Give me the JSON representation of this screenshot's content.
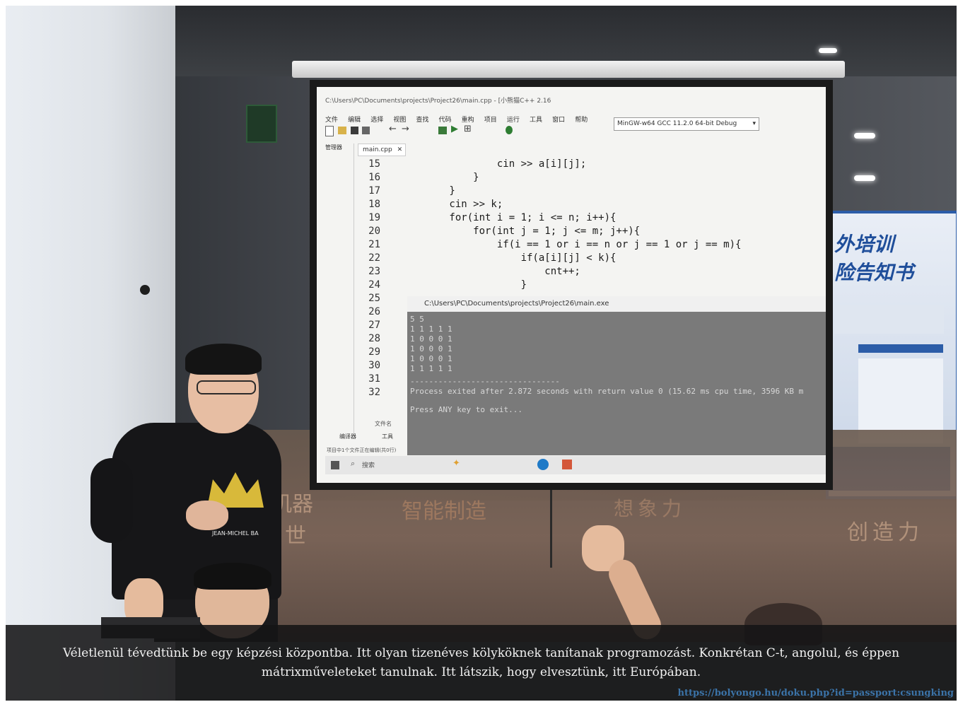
{
  "caption": {
    "line1": "Véletlenül tévedtünk be egy képzési központba. Itt olyan tizenéves kölyköknek tanítanak programozást. Konkrétan C-t, angolul, és éppen",
    "line2": "mátrixműveleteket tanulnak. Itt látszik, hogy elvesztünk, itt Európában."
  },
  "source_url": "https://bolyongo.hu/doku.php?id=passport:csungking",
  "screen": {
    "window_title": "C:\\Users\\PC\\Documents\\projects\\Project26\\main.cpp - [小熊猫C++ 2.16",
    "menu": [
      "文件",
      "编辑",
      "选择",
      "视图",
      "查找",
      "代码",
      "重构",
      "项目",
      "运行",
      "工具",
      "窗口",
      "帮助"
    ],
    "compiler_select": "MinGW-w64 GCC 11.2.0 64-bit Debug",
    "side_panel_tab": "管理器",
    "editor_tab": "main.cpp",
    "line_numbers": [
      "15",
      "16",
      "17",
      "18",
      "19",
      "20",
      "21",
      "22",
      "23",
      "24",
      "25",
      "26",
      "27",
      "28",
      "29",
      "30",
      "31",
      "32"
    ],
    "code_lines": [
      "                cin >> a[i][j];",
      "            }",
      "        }",
      "        cin >> k;",
      "        for(int i = 1; i <= n; i++){",
      "            for(int j = 1; j <= m; j++){",
      "                if(i == 1 or i == n or j == 1 or j == m){",
      "                    if(a[i][j] < k){",
      "                        cnt++;",
      "                    }"
    ],
    "console_title": "C:\\Users\\PC\\Documents\\projects\\Project26\\main.exe",
    "console_lines": [
      "5 5",
      "1 1 1 1 1",
      "1 0 0 0 1",
      "1 0 0 0 1",
      "1 0 0 0 1",
      "1 1 1 1 1"
    ],
    "console_separator": "--------------------------------",
    "console_exit": "Process exited after 2.872 seconds with return value 0 (15.62 ms cpu time, 3596 KB m",
    "console_press": "Press ANY key to exit...",
    "bottom_panel_label": "文件名",
    "bottom_tabs": [
      "编译器",
      "工具"
    ],
    "status_text": "项目中1个文件正在编辑(共0行)",
    "taskbar_search": "搜索"
  },
  "wall_sign": {
    "line1": "外培训",
    "line2": "险告知书"
  },
  "glass_lettering": [
    "机器",
    "世",
    "智能制造",
    "创造力",
    "想象力"
  ],
  "shirt_text": "JEAN-MICHEL BA",
  "colors": {
    "caption_bg": "rgba(20,20,22,0.88)",
    "caption_text": "#f2f2f2",
    "url_text": "#3b73a8",
    "screen_bg": "#f4f4f2",
    "console_bg": "#7a7a7a"
  }
}
